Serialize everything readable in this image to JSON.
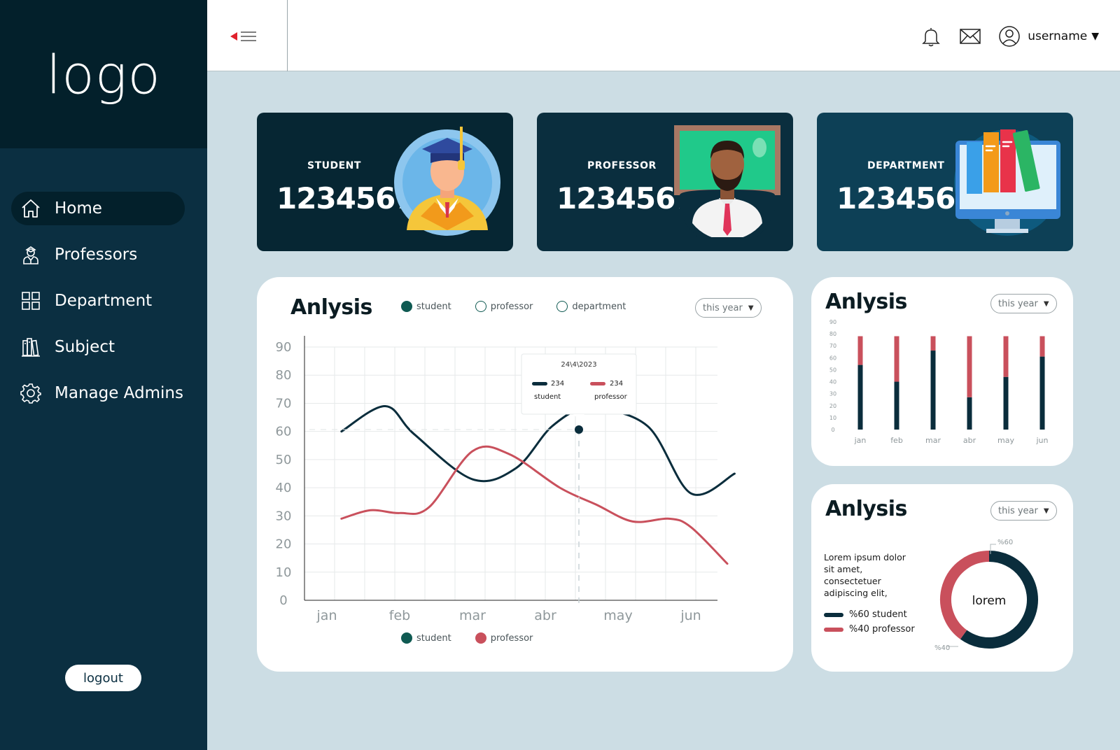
{
  "app": {
    "logo": "logo"
  },
  "sidebar": {
    "items": [
      {
        "label": "Home",
        "icon": "home-icon"
      },
      {
        "label": "Professors",
        "icon": "professor-icon"
      },
      {
        "label": "Department",
        "icon": "grid-icon"
      },
      {
        "label": "Subject",
        "icon": "books-icon"
      },
      {
        "label": "Manage Admins",
        "icon": "gear-icon"
      }
    ],
    "active_index": 0,
    "logout": "logout"
  },
  "header": {
    "user": "username",
    "icons": [
      "menu-collapse-icon",
      "bell-icon",
      "mail-icon",
      "user-icon"
    ]
  },
  "stats": [
    {
      "label": "STUDENT",
      "value": "1234567",
      "illustration": "graduate-icon"
    },
    {
      "label": "PROFESSOR",
      "value": "1234567",
      "illustration": "professor-icon"
    },
    {
      "label": "DEPARTMENT",
      "value": "1234567",
      "illustration": "books-monitor-icon"
    }
  ],
  "colors": {
    "sidebar": "#0b2f41",
    "sidebar_dark": "#03202b",
    "background": "#ccdde4",
    "student": "#0a2d3c",
    "professor": "#c9505c",
    "accent": "#0f5a52"
  },
  "analysis_main": {
    "title": "Anlysis",
    "period": "this year",
    "legend_top": [
      "student",
      "professor",
      "department"
    ],
    "legend_bottom": [
      "student",
      "professor"
    ],
    "tooltip": {
      "date": "24\\4\\2023",
      "student_value": "234",
      "student_label": "student",
      "professor_value": "234",
      "professor_label": "professor"
    }
  },
  "analysis_bar": {
    "title": "Anlysis",
    "period": "this year"
  },
  "analysis_donut": {
    "title": "Anlysis",
    "period": "this year",
    "text": "Lorem ipsum dolor sit amet, consectetuer adipiscing elit,",
    "center_label": "lorem",
    "legend": [
      "%60  student",
      "%40  professor"
    ],
    "callouts": [
      "%60",
      "%40"
    ]
  },
  "chart_data": [
    {
      "type": "line",
      "categories": [
        "jan",
        "feb",
        "mar",
        "abr",
        "may",
        "jun"
      ],
      "yticks": [
        0,
        10,
        20,
        30,
        40,
        50,
        60,
        70,
        80,
        90
      ],
      "ylim": [
        0,
        90
      ],
      "grid": true,
      "series": [
        {
          "name": "student",
          "color": "#0a2d3c",
          "x": [
            0.2,
            0.8,
            1.2,
            2.0,
            2.6,
            3.1,
            3.6,
            4.4,
            5.0,
            5.6
          ],
          "values": [
            60,
            69,
            59,
            43,
            47,
            62,
            68,
            62,
            38,
            45
          ]
        },
        {
          "name": "professor",
          "color": "#c9505c",
          "x": [
            0.2,
            0.6,
            1.0,
            1.4,
            2.0,
            2.5,
            3.2,
            3.7,
            4.2,
            4.7,
            5.0,
            5.5
          ],
          "values": [
            29,
            32,
            31,
            33,
            53,
            52,
            40,
            34,
            28,
            29,
            26,
            13
          ]
        }
      ]
    },
    {
      "type": "bar",
      "stacked": true,
      "categories": [
        "jan",
        "feb",
        "mar",
        "abr",
        "may",
        "jun"
      ],
      "yticks": [
        0,
        10,
        20,
        30,
        40,
        50,
        60,
        70,
        80,
        90
      ],
      "ylim": [
        0,
        90
      ],
      "series": [
        {
          "name": "student",
          "color": "#0a2d3c",
          "values": [
            54,
            40,
            66,
            27,
            44,
            61
          ]
        },
        {
          "name": "professor",
          "color": "#c9505c",
          "values": [
            24,
            38,
            12,
            51,
            34,
            17
          ]
        }
      ]
    },
    {
      "type": "pie",
      "donut": true,
      "labels": [
        "student",
        "professor"
      ],
      "values": [
        60,
        40
      ],
      "colors": [
        "#0a2d3c",
        "#c9505c"
      ],
      "center_label": "lorem"
    }
  ]
}
